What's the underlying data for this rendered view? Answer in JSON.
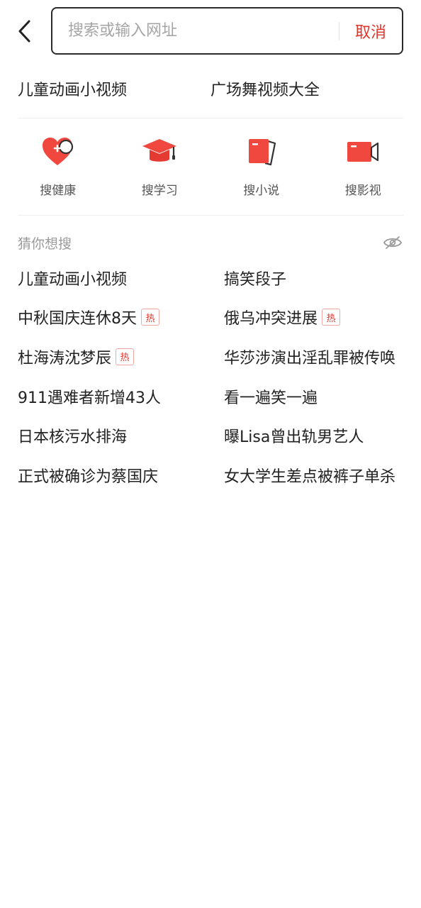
{
  "search": {
    "placeholder": "搜索或输入网址",
    "cancel_label": "取消"
  },
  "top_suggestions": [
    "儿童动画小视频",
    "广场舞视频大全"
  ],
  "quick_categories": [
    {
      "label": "搜健康",
      "icon": "heart-plus-icon"
    },
    {
      "label": "搜学习",
      "icon": "graduation-cap-icon"
    },
    {
      "label": "搜小说",
      "icon": "book-icon"
    },
    {
      "label": "搜影视",
      "icon": "video-camera-icon"
    }
  ],
  "guess": {
    "title": "猜你想搜",
    "hide_icon": "eye-hidden-icon",
    "hot_label": "热",
    "items": [
      {
        "text": "儿童动画小视频",
        "hot": false
      },
      {
        "text": "搞笑段子",
        "hot": false
      },
      {
        "text": "中秋国庆连休8天",
        "hot": true
      },
      {
        "text": "俄乌冲突进展",
        "hot": true
      },
      {
        "text": "杜海涛沈梦辰",
        "hot": true
      },
      {
        "text": "华莎涉演出淫乱罪被传唤",
        "hot": false
      },
      {
        "text": "911遇难者新增43人",
        "hot": false
      },
      {
        "text": "看一遍笑一遍",
        "hot": false
      },
      {
        "text": "日本核污水排海",
        "hot": false
      },
      {
        "text": "曝Lisa曾出轨男艺人",
        "hot": false
      },
      {
        "text": "正式被确诊为蔡国庆",
        "hot": false
      },
      {
        "text": "女大学生差点被裤子单杀",
        "hot": false
      }
    ]
  },
  "colors": {
    "accent": "#e0352b",
    "icon_red": "#f0473e",
    "text": "#222222",
    "muted": "#9a9a9a"
  }
}
